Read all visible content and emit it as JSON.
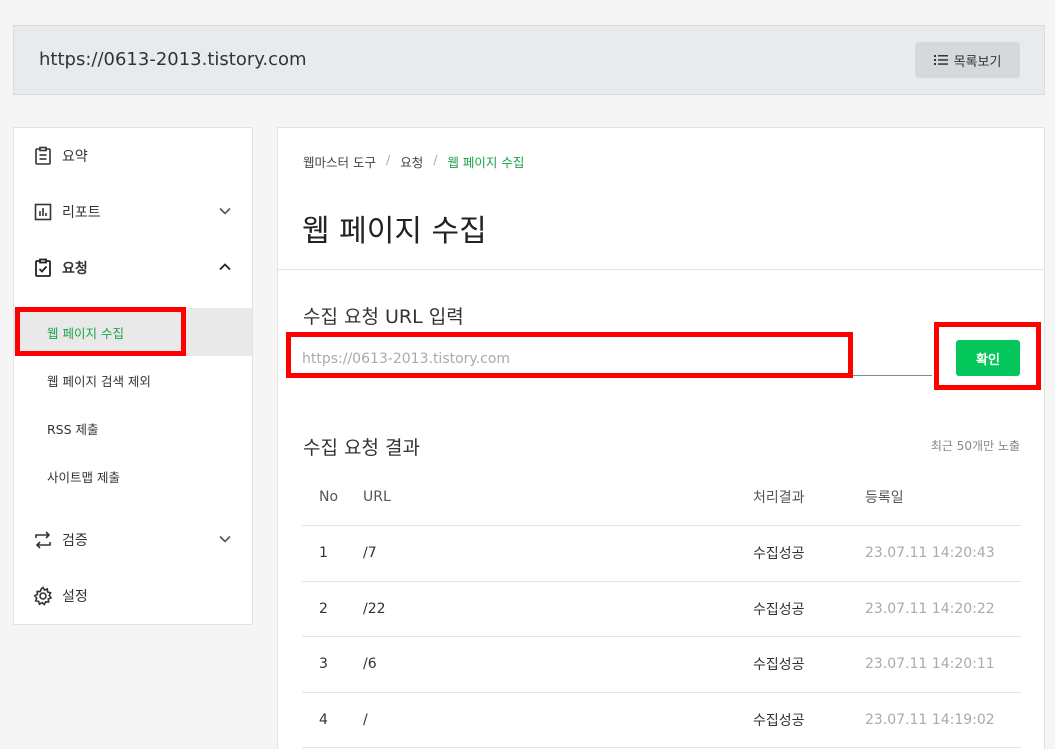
{
  "site_bar": {
    "url": "https://0613-2013.tistory.com",
    "list_button": "목록보기"
  },
  "sidebar": {
    "items": [
      {
        "label": "요약",
        "icon": "clipboard-icon"
      },
      {
        "label": "리포트",
        "icon": "chart-icon"
      },
      {
        "label": "요청",
        "icon": "clipboard-check-icon"
      },
      {
        "label": "검증",
        "icon": "swap-icon"
      },
      {
        "label": "설정",
        "icon": "gear-icon"
      }
    ],
    "sub_items": [
      {
        "label": "웹 페이지 수집",
        "active": true
      },
      {
        "label": "웹 페이지 검색 제외"
      },
      {
        "label": "RSS 제출"
      },
      {
        "label": "사이트맵 제출"
      }
    ]
  },
  "main": {
    "breadcrumb": [
      "웹마스터 도구",
      "요청",
      "웹 페이지 수집"
    ],
    "title": "웹 페이지 수집",
    "input_section_title": "수집 요청 URL 입력",
    "input_placeholder": "https://0613-2013.tistory.com",
    "confirm_button": "확인",
    "result_section_title": "수집 요청 결과",
    "result_hint": "최근 50개만 노출",
    "table": {
      "headers": [
        "No",
        "URL",
        "처리결과",
        "등록일"
      ],
      "rows": [
        [
          "1",
          "/7",
          "수집성공",
          "23.07.11 14:20:43"
        ],
        [
          "2",
          "/22",
          "수집성공",
          "23.07.11 14:20:22"
        ],
        [
          "3",
          "/6",
          "수집성공",
          "23.07.11 14:20:11"
        ],
        [
          "4",
          "/",
          "수집성공",
          "23.07.11 14:19:02"
        ]
      ]
    }
  },
  "colors": {
    "accent": "#03c75a",
    "highlight": "#ff0000"
  }
}
